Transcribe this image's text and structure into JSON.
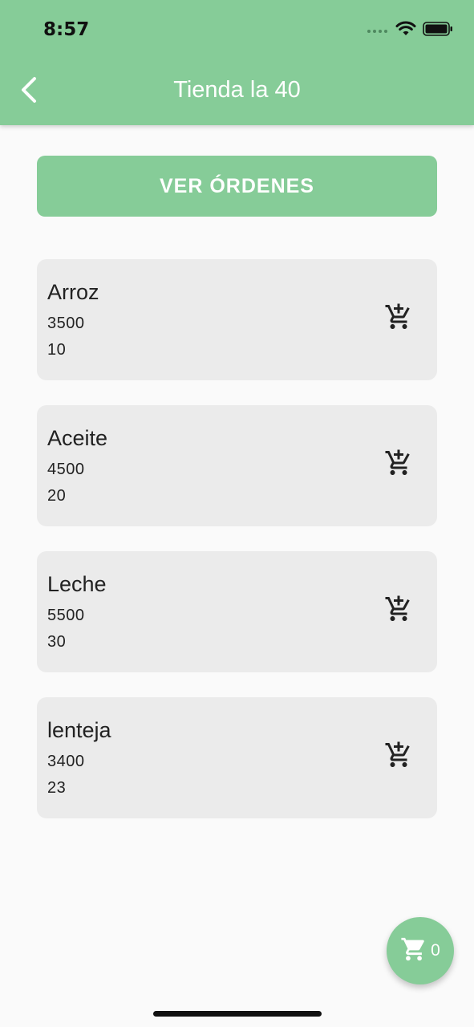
{
  "status_bar": {
    "time": "8:57"
  },
  "app_bar": {
    "title": "Tienda la 40",
    "back_icon": "chevron-left-icon",
    "background_color": "#86cc98"
  },
  "orders_button": {
    "label": "VER ÓRDENES"
  },
  "products": [
    {
      "name": "Arroz",
      "price": "3500",
      "quantity": "10",
      "action_icon": "add-shopping-cart-icon"
    },
    {
      "name": "Aceite",
      "price": "4500",
      "quantity": "20",
      "action_icon": "add-shopping-cart-icon"
    },
    {
      "name": "Leche",
      "price": "5500",
      "quantity": "30",
      "action_icon": "add-shopping-cart-icon"
    },
    {
      "name": "lenteja",
      "price": "3400",
      "quantity": "23",
      "action_icon": "add-shopping-cart-icon"
    }
  ],
  "cart_fab": {
    "icon": "shopping-cart-icon",
    "count": "0"
  }
}
